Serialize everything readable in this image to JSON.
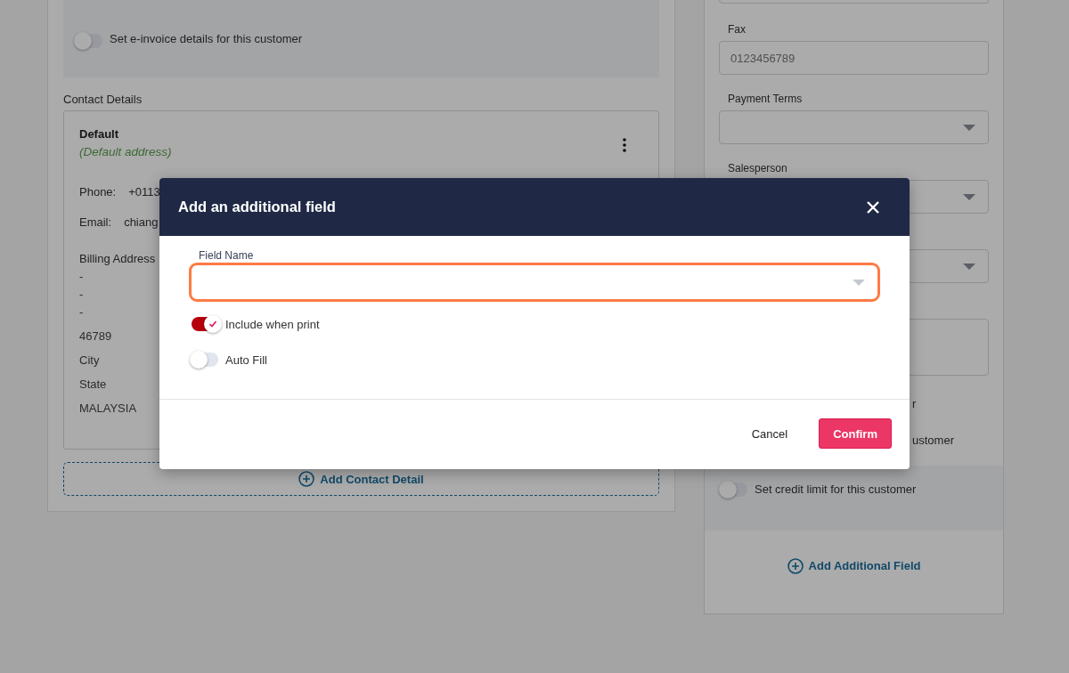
{
  "customer_form": {
    "einvoice": {
      "label": "Set e-invoice details for this customer",
      "on": false
    },
    "contact_details": {
      "title": "Contact Details",
      "contacts": [
        {
          "name": "Default",
          "tag": "(Default address)",
          "phone_label": "Phone:",
          "phone": "+0113",
          "email_label": "Email:",
          "email": "chiang",
          "billing_label": "Billing Address",
          "address_lines": [
            "-",
            "-",
            "-",
            "46789",
            "City",
            "State",
            "MALAYSIA"
          ]
        }
      ],
      "add_button": "Add Contact Detail"
    }
  },
  "side_form": {
    "fields": [
      {
        "kind": "input"
      },
      {
        "kind": "input",
        "label": "Fax",
        "placeholder": "0123456789"
      },
      {
        "kind": "select",
        "label": "Payment Terms"
      },
      {
        "kind": "select",
        "label": "Salesperson"
      },
      {
        "kind": "select"
      },
      {
        "kind": "textarea"
      }
    ],
    "partial_lines": [
      "r",
      "ustomer"
    ],
    "credit_limit": {
      "label": "Set credit limit for this customer",
      "on": false
    },
    "add_button": "Add Additional Field"
  },
  "modal": {
    "title": "Add an additional field",
    "field": {
      "label": "Field Name"
    },
    "options": [
      {
        "label": "Include when print",
        "on": true
      },
      {
        "label": "Auto Fill",
        "on": false
      }
    ],
    "buttons": [
      {
        "label": "Cancel",
        "kind": "text"
      },
      {
        "label": "Confirm",
        "kind": "primary"
      }
    ]
  }
}
